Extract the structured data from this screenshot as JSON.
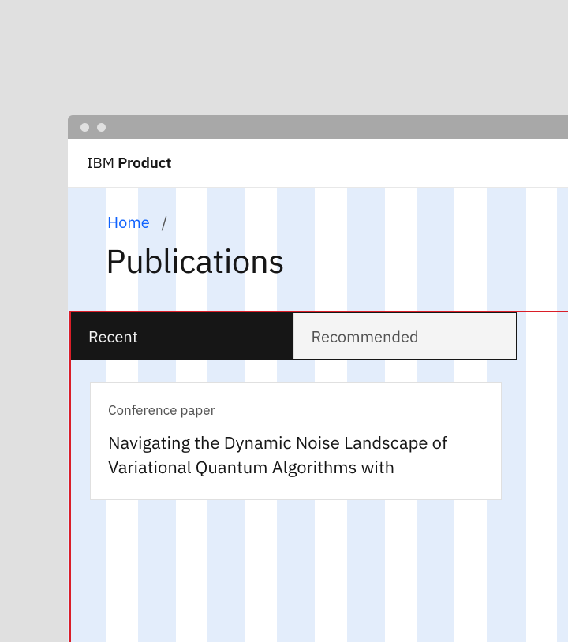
{
  "brand": {
    "prefix": "IBM",
    "name": "Product"
  },
  "breadcrumb": {
    "home": "Home",
    "sep": "/"
  },
  "page": {
    "title": "Publications"
  },
  "tabs": {
    "recent": "Recent",
    "recommended": "Recommended"
  },
  "card": {
    "type": "Conference paper",
    "title": "Navigating the Dynamic Noise Landscape of Variational Quantum Algorithms with"
  }
}
